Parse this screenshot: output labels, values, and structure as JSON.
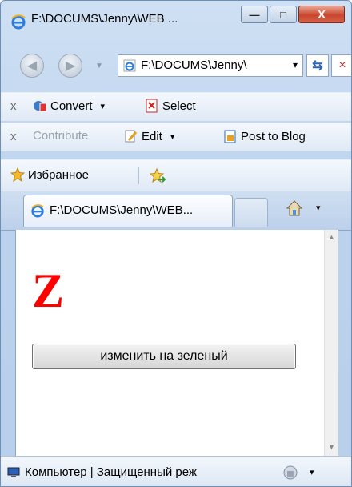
{
  "window": {
    "title": "F:\\DOCUMS\\Jenny\\WEB ...",
    "minimize_symbol": "—",
    "maximize_symbol": "□",
    "close_symbol": "X"
  },
  "nav": {
    "back_icon": "back-arrow-icon",
    "forward_icon": "forward-arrow-icon",
    "address": "F:\\DOCUMS\\Jenny\\",
    "address_dropdown": "▾",
    "refresh_icon": "refresh-icon",
    "stop_symbol": "×"
  },
  "toolbar1": {
    "close_symbol": "x",
    "convert_label": "Convert",
    "select_label": "Select",
    "dropdown_symbol": "▾"
  },
  "toolbar2": {
    "close_symbol": "x",
    "contribute_label": "Contribute",
    "edit_label": "Edit",
    "post_label": "Post to Blog",
    "dropdown_symbol": "▾"
  },
  "favorites": {
    "label": "Избранное"
  },
  "tab": {
    "label": "F:\\DOCUMS\\Jenny\\WEB...",
    "home_dropdown": "▾"
  },
  "content": {
    "letter": "Z",
    "letter_color": "#ff0000",
    "button_label": "изменить на зеленый"
  },
  "status": {
    "text": "Компьютер | Защищенный реж",
    "zone_dropdown": "▾"
  }
}
